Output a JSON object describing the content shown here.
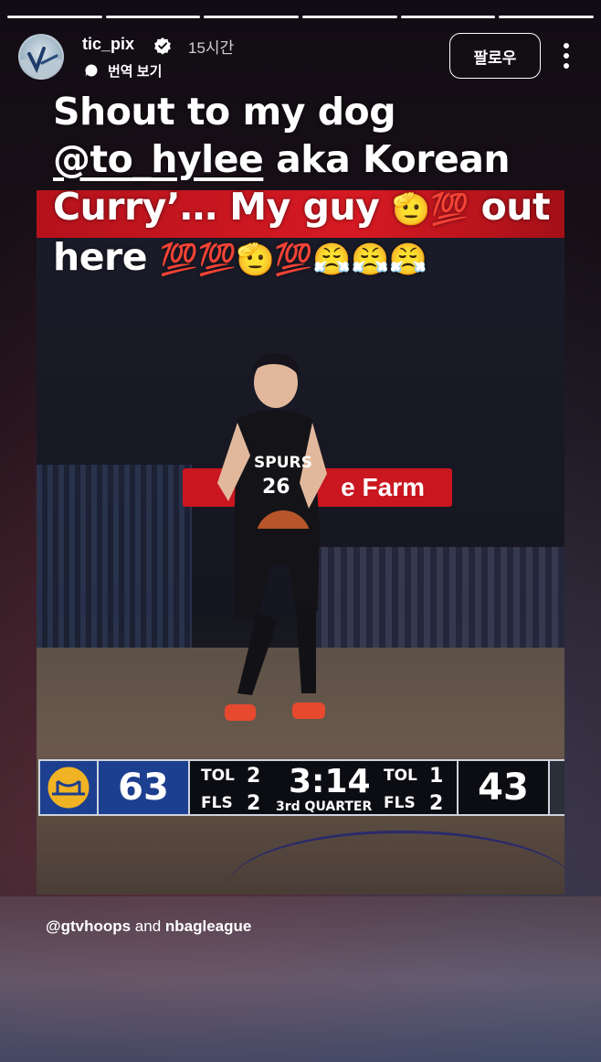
{
  "story": {
    "progress_segments": 6,
    "username": "tic_pix",
    "time": "15시간",
    "translate_label": "번역 보기",
    "follow_label": "팔로우"
  },
  "caption": {
    "part1": "Shout to my dog ",
    "mention": "@to_hylee",
    "part2": " aka Korean Curry’… My guy ",
    "emoji1": "🫡💯",
    "part3": " out here ",
    "emoji2": "💯💯🫡💯😤😤😤"
  },
  "video": {
    "arena_sign": "e Farm",
    "scoreboard": {
      "home_score": "63",
      "tol_home_label": "TOL",
      "tol_home": "2",
      "fls_home_label": "FLS",
      "fls_home": "2",
      "clock": "3:14",
      "quarter": "3rd QUARTER",
      "tol_away_label": "TOL",
      "tol_away": "1",
      "fls_away_label": "FLS",
      "fls_away": "2",
      "away_score": "43"
    },
    "jersey_team": "SPURS",
    "jersey_number": "26"
  },
  "credits": {
    "handle1": "@gtvhoops",
    "joiner": " and ",
    "handle2": "nbagleague"
  }
}
